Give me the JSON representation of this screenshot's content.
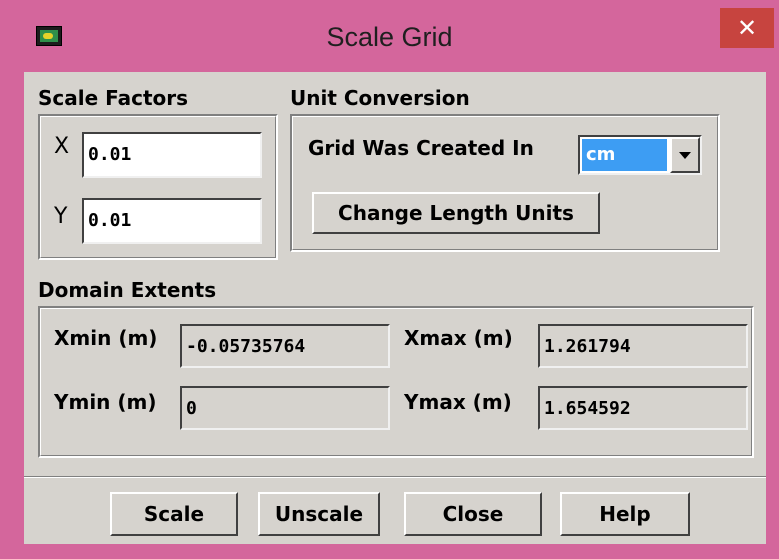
{
  "window": {
    "title": "Scale Grid",
    "close_glyph": "✕",
    "icon": "fluent-app-icon"
  },
  "scale_factors": {
    "heading": "Scale Factors",
    "x_label": "X",
    "x_value": "0.01",
    "y_label": "Y",
    "y_value": "0.01"
  },
  "unit_conversion": {
    "heading": "Unit Conversion",
    "created_in_label": "Grid Was Created In",
    "created_in_value": "cm",
    "change_button": "Change Length Units"
  },
  "domain_extents": {
    "heading": "Domain Extents",
    "xmin_label": "Xmin (m)",
    "xmin_value": "-0.05735764",
    "xmax_label": "Xmax (m)",
    "xmax_value": "1.261794",
    "ymin_label": "Ymin (m)",
    "ymin_value": "0",
    "ymax_label": "Ymax (m)",
    "ymax_value": "1.654592"
  },
  "buttons": {
    "scale": "Scale",
    "unscale": "Unscale",
    "close": "Close",
    "help": "Help"
  },
  "colors": {
    "titlebar": "#d4669c",
    "close_button": "#c7443f",
    "panel": "#d6d3ce",
    "selection": "#3d9df3"
  }
}
